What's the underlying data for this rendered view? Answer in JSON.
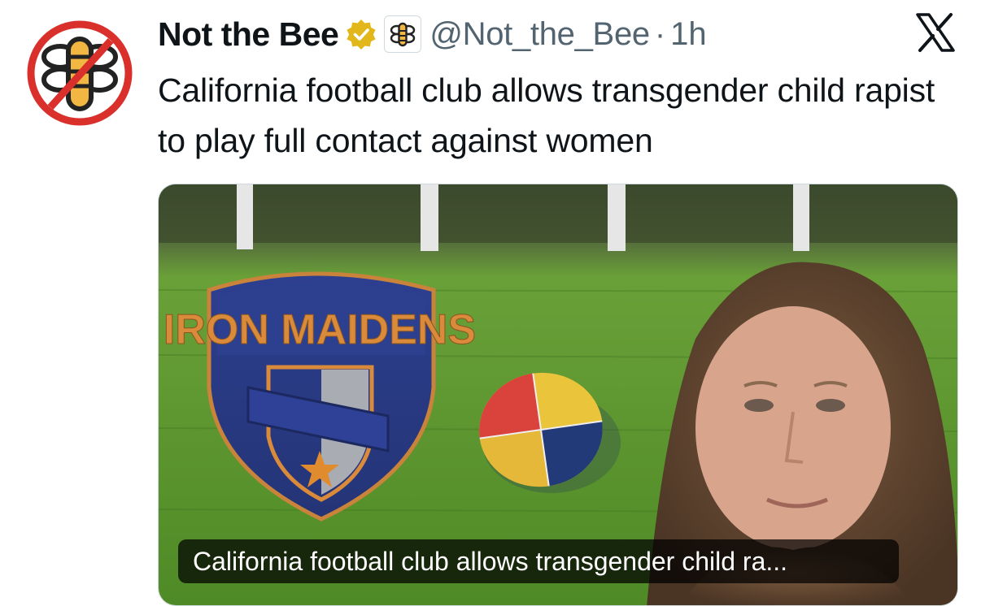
{
  "author": {
    "name": "Not the Bee",
    "handle": "@Not_the_Bee",
    "separator": "·",
    "time": "1h"
  },
  "tweet": {
    "text": "California football club allows transgender child rapist to play full contact against women"
  },
  "media": {
    "shield_text": "IRON MAIDENS",
    "caption": "California football club allows transgender child ra..."
  },
  "icons": {
    "avatar": "not-the-bee-logo",
    "verified": "gold-verified-badge",
    "affiliate": "bee-affiliate-badge",
    "platform": "x-logo"
  },
  "colors": {
    "verified_gold": "#e2b719",
    "handle_gray": "#536471",
    "logo_red": "#d9302c",
    "logo_yellow": "#f2b642"
  }
}
